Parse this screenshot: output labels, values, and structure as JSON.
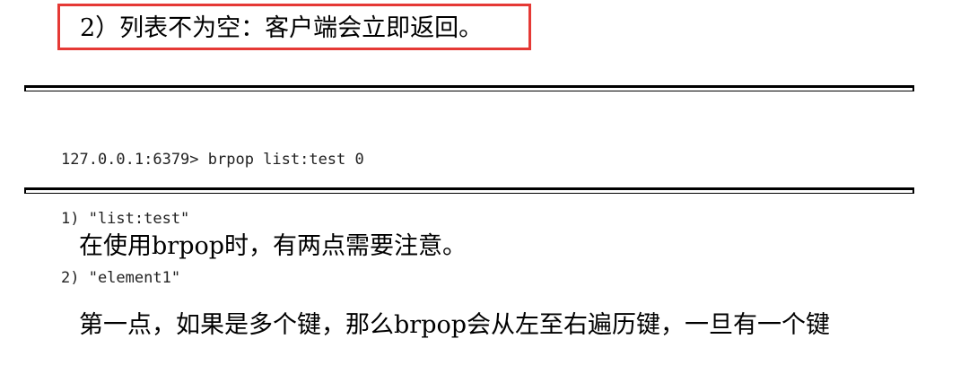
{
  "heading": "2）列表不为空：客户端会立即返回。",
  "code": {
    "lines": [
      "127.0.0.1:6379> brpop list:test 0",
      "1) \"list:test\"",
      "2) \"element1\""
    ]
  },
  "paragraphs": [
    "在使用brpop时，有两点需要注意。",
    "第一点，如果是多个键，那么brpop会从左至右遍历键，一旦有一个键"
  ],
  "colors": {
    "highlight_border": "#e53935"
  }
}
